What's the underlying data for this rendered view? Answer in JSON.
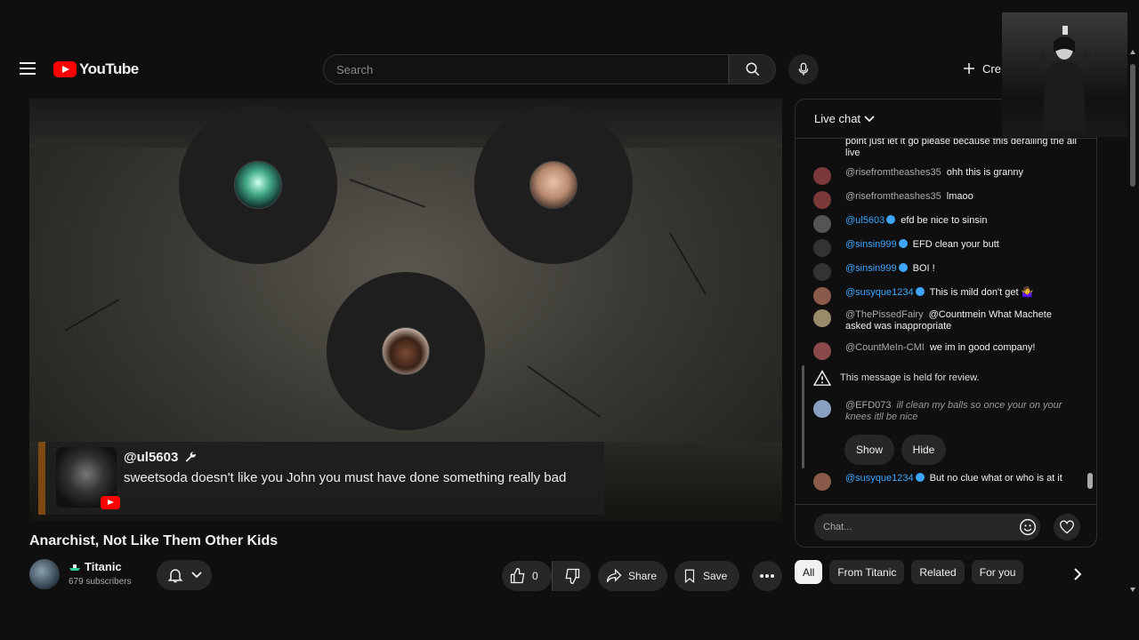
{
  "header": {
    "logo_text": "YouTube",
    "search_placeholder": "Search",
    "create_label": "Cre"
  },
  "player": {
    "overlay_author": "@ul5603",
    "overlay_message": "sweetsoda doesn't like you John you must have done something really bad"
  },
  "video": {
    "title": "Anarchist, Not Like Them Other Kids",
    "channel_name": "Titanic",
    "subscribers": "679 subscribers",
    "like_count": "0",
    "share_label": "Share",
    "save_label": "Save"
  },
  "chips": [
    "All",
    "From Titanic",
    "Related",
    "For you"
  ],
  "chat": {
    "title": "Live chat",
    "messages": [
      {
        "author": "",
        "text": "point just let it go please because this derailing the all live"
      },
      {
        "author": "@risefromtheashes35",
        "text": "ohh this is granny"
      },
      {
        "author": "@risefromtheashes35",
        "text": "lmaoo"
      },
      {
        "author": "@ul5603",
        "text": "efd be nice to sinsin"
      },
      {
        "author": "@sinsin999",
        "text": "EFD clean your butt"
      },
      {
        "author": "@sinsin999",
        "text": "BOI !"
      },
      {
        "author": "@susyque1234",
        "text": "This is mild don't get 🤷‍♀️"
      },
      {
        "author": "@ThePissedFairy",
        "text": "@Countmein What Machete asked was inappropriate"
      },
      {
        "author": "@CountMeIn-CMI",
        "text": "we im in good company!"
      },
      {
        "author": "@EFD073",
        "text": "ill clean my balls so once your on your knees itll be nice"
      },
      {
        "author": "@susyque1234",
        "text": "But no clue what or who is at it"
      }
    ],
    "held_notice": "This message is held for review.",
    "show_label": "Show",
    "hide_label": "Hide",
    "input_placeholder": "Chat..."
  },
  "colors": {
    "background": "#0f0f0f",
    "brand_red": "#ff0000",
    "member_blue": "#3ea6ff"
  }
}
